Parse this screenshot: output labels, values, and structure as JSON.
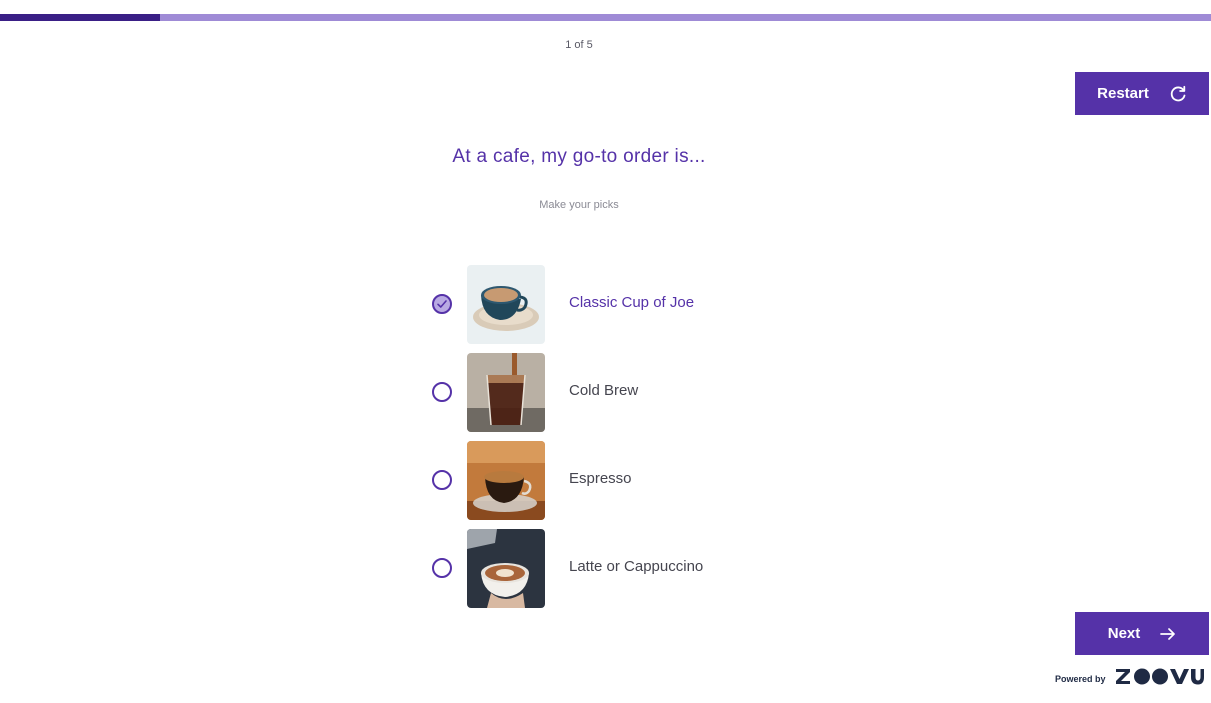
{
  "progress": {
    "fraction": 0.132,
    "label": "1 of 5"
  },
  "colors": {
    "accent": "#5532a8",
    "progress_dark": "#3a1f86",
    "progress_light": "#9f8bd6"
  },
  "restart": {
    "label": "Restart",
    "icon": "refresh-icon"
  },
  "question": {
    "title": "At a cafe, my go-to order is...",
    "hint": "Make your picks"
  },
  "options": [
    {
      "label": "Classic Cup of Joe",
      "selected": true,
      "image": "coffee-cup-image"
    },
    {
      "label": "Cold Brew",
      "selected": false,
      "image": "cold-brew-image"
    },
    {
      "label": "Espresso",
      "selected": false,
      "image": "espresso-image"
    },
    {
      "label": "Latte or Cappuccino",
      "selected": false,
      "image": "latte-image"
    }
  ],
  "next": {
    "label": "Next",
    "icon": "arrow-right-icon"
  },
  "footer": {
    "powered_by": "Powered by",
    "brand": "ZOOVU"
  }
}
